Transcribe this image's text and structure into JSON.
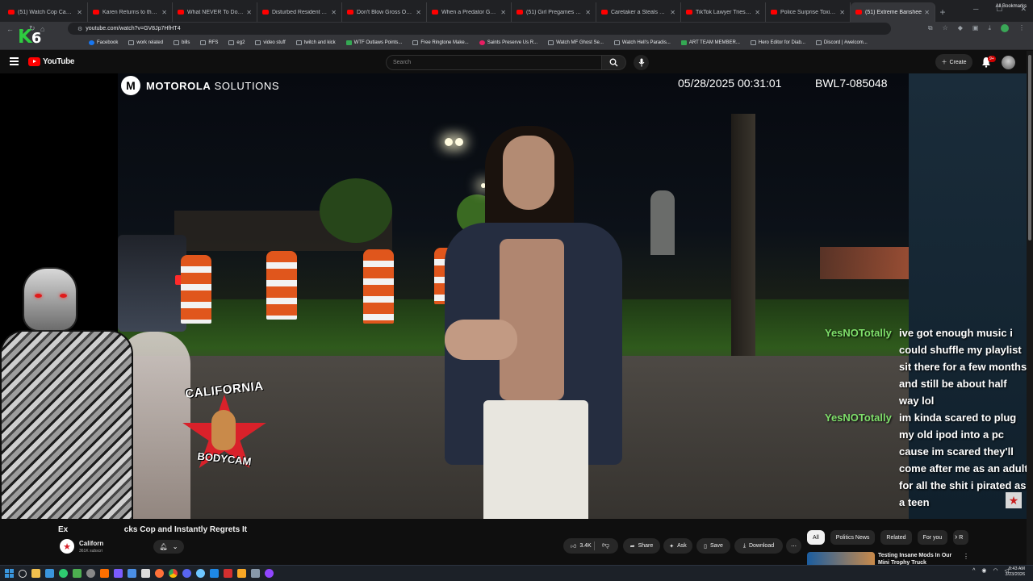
{
  "browser": {
    "tabs": [
      {
        "title": "(51) Watch Cop Cam - Yo",
        "active": false
      },
      {
        "title": "Karen Returns to the Gas",
        "active": false
      },
      {
        "title": "What NEVER To Do During",
        "active": false
      },
      {
        "title": "Disturbed Resident Attem",
        "active": false
      },
      {
        "title": "Don't Blow Gross On Her",
        "active": false
      },
      {
        "title": "When a Predator Gets Ca",
        "active": false
      },
      {
        "title": "(51) Girl Pregames Thanks",
        "active": false
      },
      {
        "title": "Caretaker a Steals Badge",
        "active": false
      },
      {
        "title": "TikTok Lawyer Tries to Bu",
        "active": false
      },
      {
        "title": "Police Surprise Toxic Coup",
        "active": false
      },
      {
        "title": "(51) Extreme Banshee",
        "active": true
      }
    ],
    "url": "youtube.com/watch?v=GV8Jp7HfHT4",
    "bookmarks": [
      {
        "label": "Facebook",
        "icon": "facebook-icon"
      },
      {
        "label": "work related",
        "icon": "folder-icon"
      },
      {
        "label": "bills",
        "icon": "folder-icon"
      },
      {
        "label": "RFS",
        "icon": "folder-icon"
      },
      {
        "label": "eg2",
        "icon": "folder-icon"
      },
      {
        "label": "video stuff",
        "icon": "folder-icon"
      },
      {
        "label": "twitch and kick",
        "icon": "folder-icon"
      },
      {
        "label": "WTF Outlaws Points...",
        "icon": "green-icon"
      },
      {
        "label": "Free Ringtone Make...",
        "icon": "page-icon"
      },
      {
        "label": "Saints Preserve Us R...",
        "icon": "pink-icon"
      },
      {
        "label": "Watch MF Ghost Se...",
        "icon": "page-icon"
      },
      {
        "label": "Watch Hell's Paradis...",
        "icon": "page-icon"
      },
      {
        "label": "ART TEAM MEMBER...",
        "icon": "green-icon"
      },
      {
        "label": "Hero Editor for Diab...",
        "icon": "page-icon"
      },
      {
        "label": "Discord | #welcom...",
        "icon": "page-icon"
      }
    ],
    "all_bookmarks": "All Bookmarks"
  },
  "overlay_logo": {
    "k": "K",
    "six": "6"
  },
  "youtube": {
    "brand": "YouTube",
    "search_placeholder": "Search",
    "create_label": "Create",
    "notif_badge": "9+"
  },
  "video": {
    "brand_bold": "MOTOROLA",
    "brand_light": " SOLUTIONS",
    "moto_mark": "M",
    "timestamp": "05/28/2025 00:31:01",
    "camera_id": "BWL7-085048",
    "channel_logo_top": "CALIFORNIA",
    "channel_logo_bottom": "BODYCAM"
  },
  "chat": [
    {
      "user": "YesNOTotally",
      "text": "ive got enough music i could shuffle my playlist sit there for a few months and still be about half way lol"
    },
    {
      "user": "YesNOTotally",
      "text": "im kinda scared to plug my old ipod into a pc cause im scared they'll come after me as an adult for all the shit i pirated as a teen"
    }
  ],
  "below": {
    "title_prefix": "Ex",
    "title_rest": "cks Cop and Instantly Regrets It",
    "channel_name": "Californ",
    "channel_subs": "361K subscri",
    "likes": "3.4K",
    "actions": {
      "share": "Share",
      "ask": "Ask",
      "save": "Save",
      "download": "Download"
    },
    "chips": [
      "All",
      "Politics News",
      "Related",
      "For you",
      "R"
    ],
    "reco_title": "Testing Insane Mods In Our Mini Trophy Truck"
  },
  "taskbar": {
    "time": "8:43 AM",
    "date": "3/23/2026"
  },
  "colors": {
    "chat_user": "#7fe06b",
    "yt_red": "#ff0000",
    "accent_green": "#2ecc40"
  }
}
